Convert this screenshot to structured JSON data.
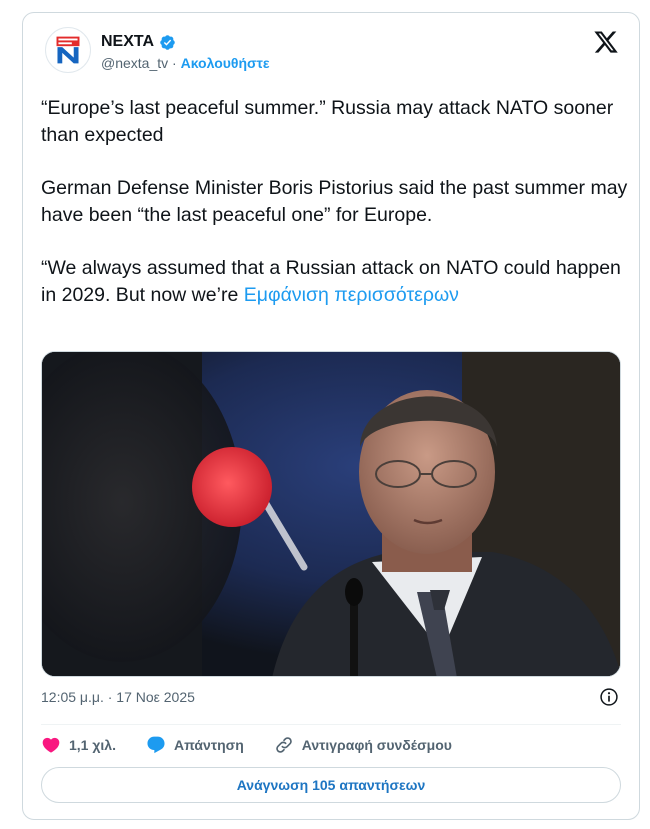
{
  "author": {
    "name": "NEXTA",
    "handle": "@nexta_tv",
    "separator": "·",
    "follow_label": "Ακολουθήστε"
  },
  "tweet": {
    "paragraphs": [
      "“Europe’s last peaceful summer.” Russia may attack NATO sooner than expected",
      "German Defense Minister Boris Pistorius said the past summer may have been “the last peaceful one” for Europe.",
      "“We always assumed that a Russian attack on NATO could happen in 2029. But now we’re"
    ],
    "show_more": "Εμφάνιση περισσότερων"
  },
  "timestamp": "12:05 μ.μ. · 17 Νοε 2025",
  "actions": {
    "likes": "1,1 χιλ.",
    "reply": "Απάντηση",
    "copy_link": "Αντιγραφή συνδέσμου"
  },
  "read_replies": "Ανάγνωση 105 απαντήσεων",
  "icons": [
    "nexta-logo-icon",
    "verified-badge-icon",
    "x-logo-icon",
    "info-icon",
    "heart-icon",
    "reply-bubble-icon",
    "link-icon"
  ],
  "colors": {
    "accent": "#1d9bf0",
    "heart": "#f91880",
    "text": "#0f1419",
    "muted": "#536471"
  }
}
